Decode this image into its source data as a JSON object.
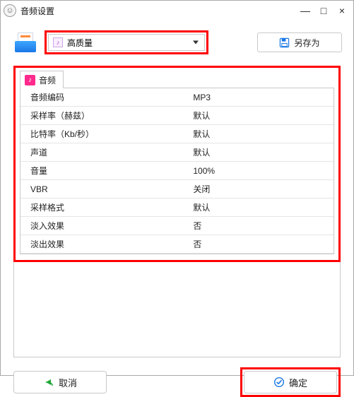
{
  "window": {
    "title": "音频设置",
    "minimize": "—",
    "maximize": "□",
    "close": "×"
  },
  "preset": {
    "selected": "高质量",
    "mini_glyph": "♪"
  },
  "saveas": {
    "label": "另存为"
  },
  "tab": {
    "label": "音频",
    "glyph": "♪"
  },
  "rows": [
    {
      "key": "音频编码",
      "value": "MP3"
    },
    {
      "key": "采样率（赫兹）",
      "value": "默认"
    },
    {
      "key": "比特率（Kb/秒）",
      "value": "默认"
    },
    {
      "key": "声道",
      "value": "默认"
    },
    {
      "key": "音量",
      "value": "100%"
    },
    {
      "key": "VBR",
      "value": "关闭"
    },
    {
      "key": "采样格式",
      "value": "默认"
    },
    {
      "key": "淡入效果",
      "value": "否"
    },
    {
      "key": "淡出效果",
      "value": "否"
    }
  ],
  "buttons": {
    "cancel": "取消",
    "ok": "确定"
  },
  "colors": {
    "highlight": "#ff0000",
    "accent_blue": "#1b77e6",
    "accent_pink": "#ff2a8d"
  }
}
